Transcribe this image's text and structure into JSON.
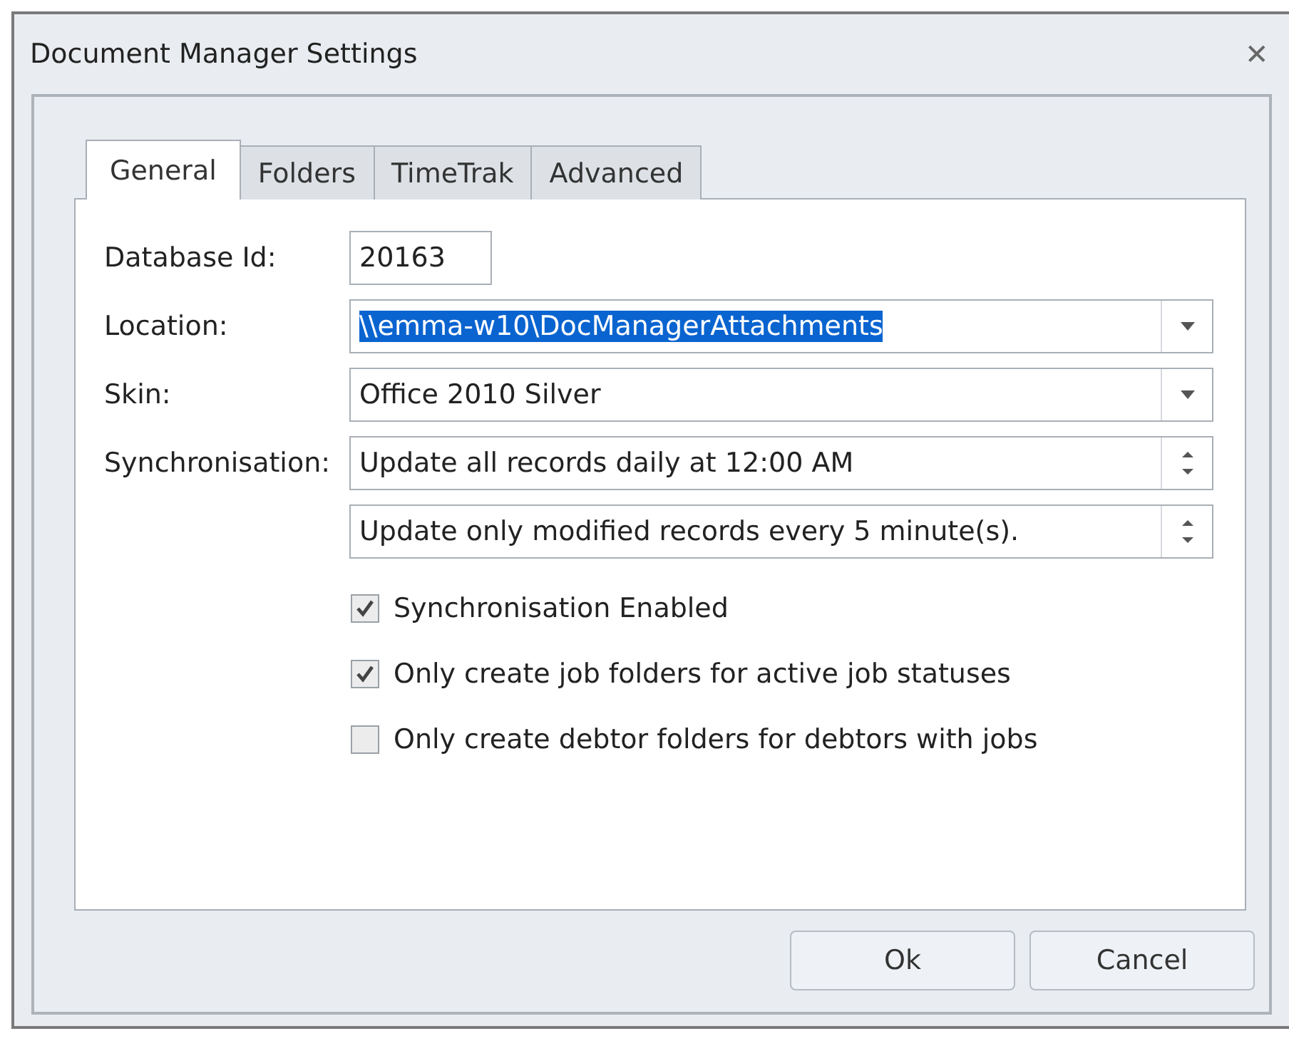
{
  "window": {
    "title": "Document Manager Settings",
    "close_icon": "✕"
  },
  "tabs": [
    {
      "label": "General",
      "selected": true
    },
    {
      "label": "Folders",
      "selected": false
    },
    {
      "label": "TimeTrak",
      "selected": false
    },
    {
      "label": "Advanced",
      "selected": false
    }
  ],
  "fields": [
    {
      "label": "Database Id:",
      "kind": "text",
      "value": "20163"
    },
    {
      "label": "Location:",
      "kind": "combo",
      "value": "\\\\emma-w10\\DocManagerAttachments",
      "text_selected": true
    },
    {
      "label": "Skin:",
      "kind": "combo",
      "value": "Office 2010 Silver",
      "text_selected": false
    },
    {
      "label": "Synchronisation:",
      "kind": "spin",
      "value": "Update all records daily at 12:00 AM"
    },
    {
      "kind": "spin",
      "value": "Update only modified records every 5 minute(s)."
    }
  ],
  "checkboxes": [
    {
      "label": "Synchronisation Enabled",
      "checked": true
    },
    {
      "label": "Only create job folders for active job statuses",
      "checked": true
    },
    {
      "label": "Only create debtor folders for debtors with jobs",
      "checked": false
    }
  ],
  "buttons": [
    "Ok",
    "Cancel"
  ]
}
